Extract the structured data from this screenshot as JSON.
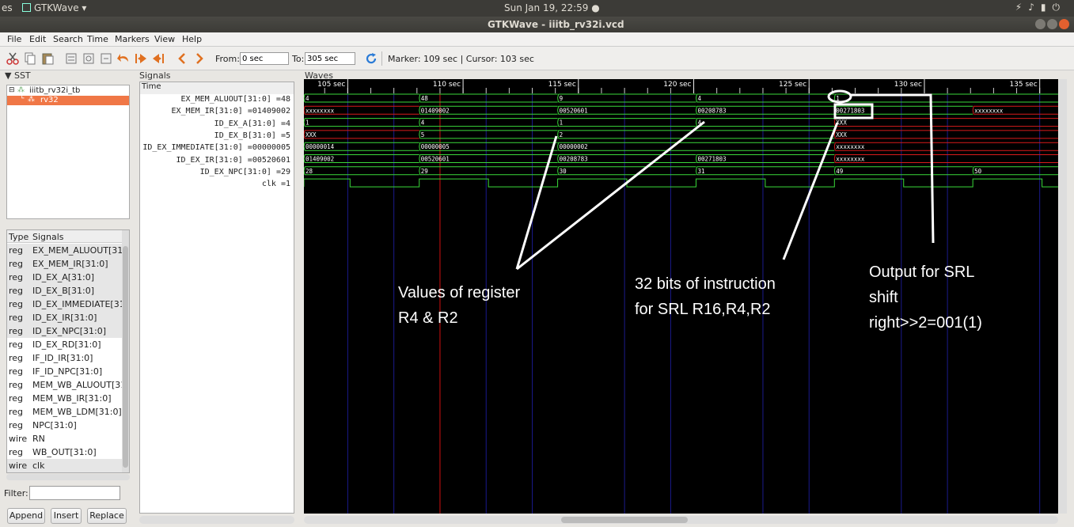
{
  "topbar": {
    "left_text": "es",
    "app_name": "GTKWave ▾",
    "clock": "Sun Jan 19, 22:59 ●"
  },
  "window": {
    "title": "GTKWave - iiitb_rv32i.vcd"
  },
  "menu": [
    "File",
    "Edit",
    "Search",
    "Time",
    "Markers",
    "View",
    "Help"
  ],
  "toolbar": {
    "from_label": "From:",
    "from_value": "0 sec",
    "to_label": "To:",
    "to_value": "305 sec",
    "marker_cursor": "Marker: 109 sec  |  Cursor: 103 sec"
  },
  "sst": {
    "header": "▼ SST",
    "tree": [
      {
        "label": "iiitb_rv32i_tb",
        "selected": false
      },
      {
        "label": "rv32",
        "selected": true
      }
    ]
  },
  "type_signals": {
    "col_type": "Type",
    "col_signals": "Signals",
    "rows": [
      {
        "type": "reg",
        "signal": "EX_MEM_ALUOUT[31:0",
        "hl": true
      },
      {
        "type": "reg",
        "signal": "EX_MEM_IR[31:0]",
        "hl": true
      },
      {
        "type": "reg",
        "signal": "ID_EX_A[31:0]",
        "hl": true
      },
      {
        "type": "reg",
        "signal": "ID_EX_B[31:0]",
        "hl": true
      },
      {
        "type": "reg",
        "signal": "ID_EX_IMMEDIATE[31:0",
        "hl": true
      },
      {
        "type": "reg",
        "signal": "ID_EX_IR[31:0]",
        "hl": true
      },
      {
        "type": "reg",
        "signal": "ID_EX_NPC[31:0]",
        "hl": true
      },
      {
        "type": "reg",
        "signal": "ID_EX_RD[31:0]",
        "hl": false
      },
      {
        "type": "reg",
        "signal": "IF_ID_IR[31:0]",
        "hl": false
      },
      {
        "type": "reg",
        "signal": "IF_ID_NPC[31:0]",
        "hl": false
      },
      {
        "type": "reg",
        "signal": "MEM_WB_ALUOUT[31:",
        "hl": false
      },
      {
        "type": "reg",
        "signal": "MEM_WB_IR[31:0]",
        "hl": false
      },
      {
        "type": "reg",
        "signal": "MEM_WB_LDM[31:0]",
        "hl": false
      },
      {
        "type": "reg",
        "signal": "NPC[31:0]",
        "hl": false
      },
      {
        "type": "wire",
        "signal": "RN",
        "hl": false
      },
      {
        "type": "reg",
        "signal": "WB_OUT[31:0]",
        "hl": false
      },
      {
        "type": "wire",
        "signal": "clk",
        "hl": true
      }
    ]
  },
  "filter_label": "Filter:",
  "buttons": {
    "append": "Append",
    "insert": "Insert",
    "replace": "Replace"
  },
  "signals_panel": {
    "header": "Signals",
    "time_label": "Time",
    "rows": [
      "EX_MEM_ALUOUT[31:0] =48",
      "EX_MEM_IR[31:0] =01409002",
      "ID_EX_A[31:0] =4",
      "ID_EX_B[31:0] =5",
      "ID_EX_IMMEDIATE[31:0] =00000005",
      "ID_EX_IR[31:0] =00520601",
      "ID_EX_NPC[31:0] =29",
      "clk =1"
    ]
  },
  "waves": {
    "header": "Waves",
    "time_start": 103.1,
    "time_end": 135.8,
    "ruler_labels": [
      {
        "t": 105,
        "text": "105 sec"
      },
      {
        "t": 110,
        "text": "110 sec"
      },
      {
        "t": 115,
        "text": "115 sec"
      },
      {
        "t": 120,
        "text": "120 sec"
      },
      {
        "t": 125,
        "text": "125 sec"
      },
      {
        "t": 130,
        "text": "130 sec"
      },
      {
        "t": 135,
        "text": "135 sec"
      }
    ],
    "marker_t": 109,
    "clock_edges": [
      105,
      107,
      111,
      113,
      117,
      119,
      123,
      125,
      129,
      131,
      135
    ],
    "tracks": [
      {
        "segments": [
          {
            "t0": 103.1,
            "t1": 108.1,
            "val": "4",
            "color": "green"
          },
          {
            "t0": 108.1,
            "t1": 114.1,
            "val": "48",
            "color": "green"
          },
          {
            "t0": 114.1,
            "t1": 120.1,
            "val": "9",
            "color": "green"
          },
          {
            "t0": 120.1,
            "t1": 126.1,
            "val": "4",
            "color": "green"
          },
          {
            "t0": 126.1,
            "t1": 135.8,
            "val": "1",
            "color": "green"
          }
        ]
      },
      {
        "segments": [
          {
            "t0": 103.1,
            "t1": 108.1,
            "val": "xxxxxxxx",
            "color": "red"
          },
          {
            "t0": 108.1,
            "t1": 114.1,
            "val": "01409002",
            "color": "green"
          },
          {
            "t0": 114.1,
            "t1": 120.1,
            "val": "00520601",
            "color": "green"
          },
          {
            "t0": 120.1,
            "t1": 126.1,
            "val": "00208783",
            "color": "green"
          },
          {
            "t0": 126.1,
            "t1": 132.1,
            "val": "00271803",
            "color": "green"
          },
          {
            "t0": 132.1,
            "t1": 135.8,
            "val": "xxxxxxxx",
            "color": "red"
          }
        ]
      },
      {
        "segments": [
          {
            "t0": 103.1,
            "t1": 108.1,
            "val": "1",
            "color": "green"
          },
          {
            "t0": 108.1,
            "t1": 114.1,
            "val": "4",
            "color": "green"
          },
          {
            "t0": 114.1,
            "t1": 120.1,
            "val": "1",
            "color": "green"
          },
          {
            "t0": 120.1,
            "t1": 126.1,
            "val": "4",
            "color": "green"
          },
          {
            "t0": 126.1,
            "t1": 135.8,
            "val": "XXX",
            "color": "red"
          }
        ]
      },
      {
        "segments": [
          {
            "t0": 103.1,
            "t1": 108.1,
            "val": "XXX",
            "color": "red"
          },
          {
            "t0": 108.1,
            "t1": 114.1,
            "val": "5",
            "color": "green"
          },
          {
            "t0": 114.1,
            "t1": 126.1,
            "val": "2",
            "color": "green"
          },
          {
            "t0": 126.1,
            "t1": 135.8,
            "val": "XXX",
            "color": "red"
          }
        ]
      },
      {
        "segments": [
          {
            "t0": 103.1,
            "t1": 108.1,
            "val": "00000014",
            "color": "green"
          },
          {
            "t0": 108.1,
            "t1": 114.1,
            "val": "00000005",
            "color": "green"
          },
          {
            "t0": 114.1,
            "t1": 126.1,
            "val": "00000002",
            "color": "green"
          },
          {
            "t0": 126.1,
            "t1": 135.8,
            "val": "xxxxxxxx",
            "color": "red"
          }
        ]
      },
      {
        "segments": [
          {
            "t0": 103.1,
            "t1": 108.1,
            "val": "01409002",
            "color": "green"
          },
          {
            "t0": 108.1,
            "t1": 114.1,
            "val": "00520601",
            "color": "green"
          },
          {
            "t0": 114.1,
            "t1": 120.1,
            "val": "00208783",
            "color": "green"
          },
          {
            "t0": 120.1,
            "t1": 126.1,
            "val": "00271803",
            "color": "green"
          },
          {
            "t0": 126.1,
            "t1": 135.8,
            "val": "xxxxxxxx",
            "color": "red"
          }
        ]
      },
      {
        "segments": [
          {
            "t0": 103.1,
            "t1": 108.1,
            "val": "28",
            "color": "green"
          },
          {
            "t0": 108.1,
            "t1": 114.1,
            "val": "29",
            "color": "green"
          },
          {
            "t0": 114.1,
            "t1": 120.1,
            "val": "30",
            "color": "green"
          },
          {
            "t0": 120.1,
            "t1": 126.1,
            "val": "31",
            "color": "green"
          },
          {
            "t0": 126.1,
            "t1": 132.1,
            "val": "49",
            "color": "green"
          },
          {
            "t0": 132.1,
            "t1": 135.8,
            "val": "50",
            "color": "green"
          }
        ]
      }
    ],
    "clk": {
      "high": [
        [
          103.1,
          105.1
        ],
        [
          108.1,
          111.1
        ],
        [
          114.1,
          117.1
        ],
        [
          120.1,
          123.1
        ],
        [
          126.1,
          129.1
        ],
        [
          132.1,
          135.1
        ]
      ]
    }
  },
  "annotations": {
    "values": [
      "Values of register",
      "R4 & R2"
    ],
    "instr": [
      "32 bits of instruction",
      "for SRL R16,R4,R2"
    ],
    "output": [
      "Output for SRL",
      "shift",
      "right>>2=001(1)"
    ]
  },
  "colors": {
    "wave_green": "#3ad93a",
    "wave_red": "#d81b1b",
    "selection": "#f07746",
    "grid_blue": "#1a1a8c",
    "marker_red": "#d01010"
  }
}
